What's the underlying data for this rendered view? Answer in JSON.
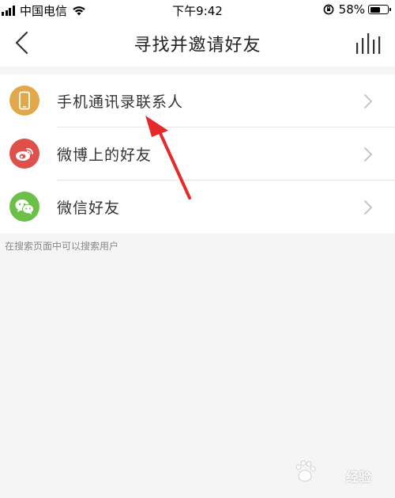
{
  "status_bar": {
    "carrier": "中国电信",
    "time": "下午9:42",
    "battery_percent": "58%",
    "battery_level": 0.58
  },
  "nav": {
    "title": "寻找并邀请好友"
  },
  "list": {
    "items": [
      {
        "label": "手机通讯录联系人",
        "icon": "phone-icon",
        "color": "#E0A84A"
      },
      {
        "label": "微博上的好友",
        "icon": "weibo-icon",
        "color": "#E0504A"
      },
      {
        "label": "微信好友",
        "icon": "wechat-icon",
        "color": "#6CC04A"
      }
    ]
  },
  "hint": "在搜索页面中可以搜索用户",
  "watermark": "经验"
}
